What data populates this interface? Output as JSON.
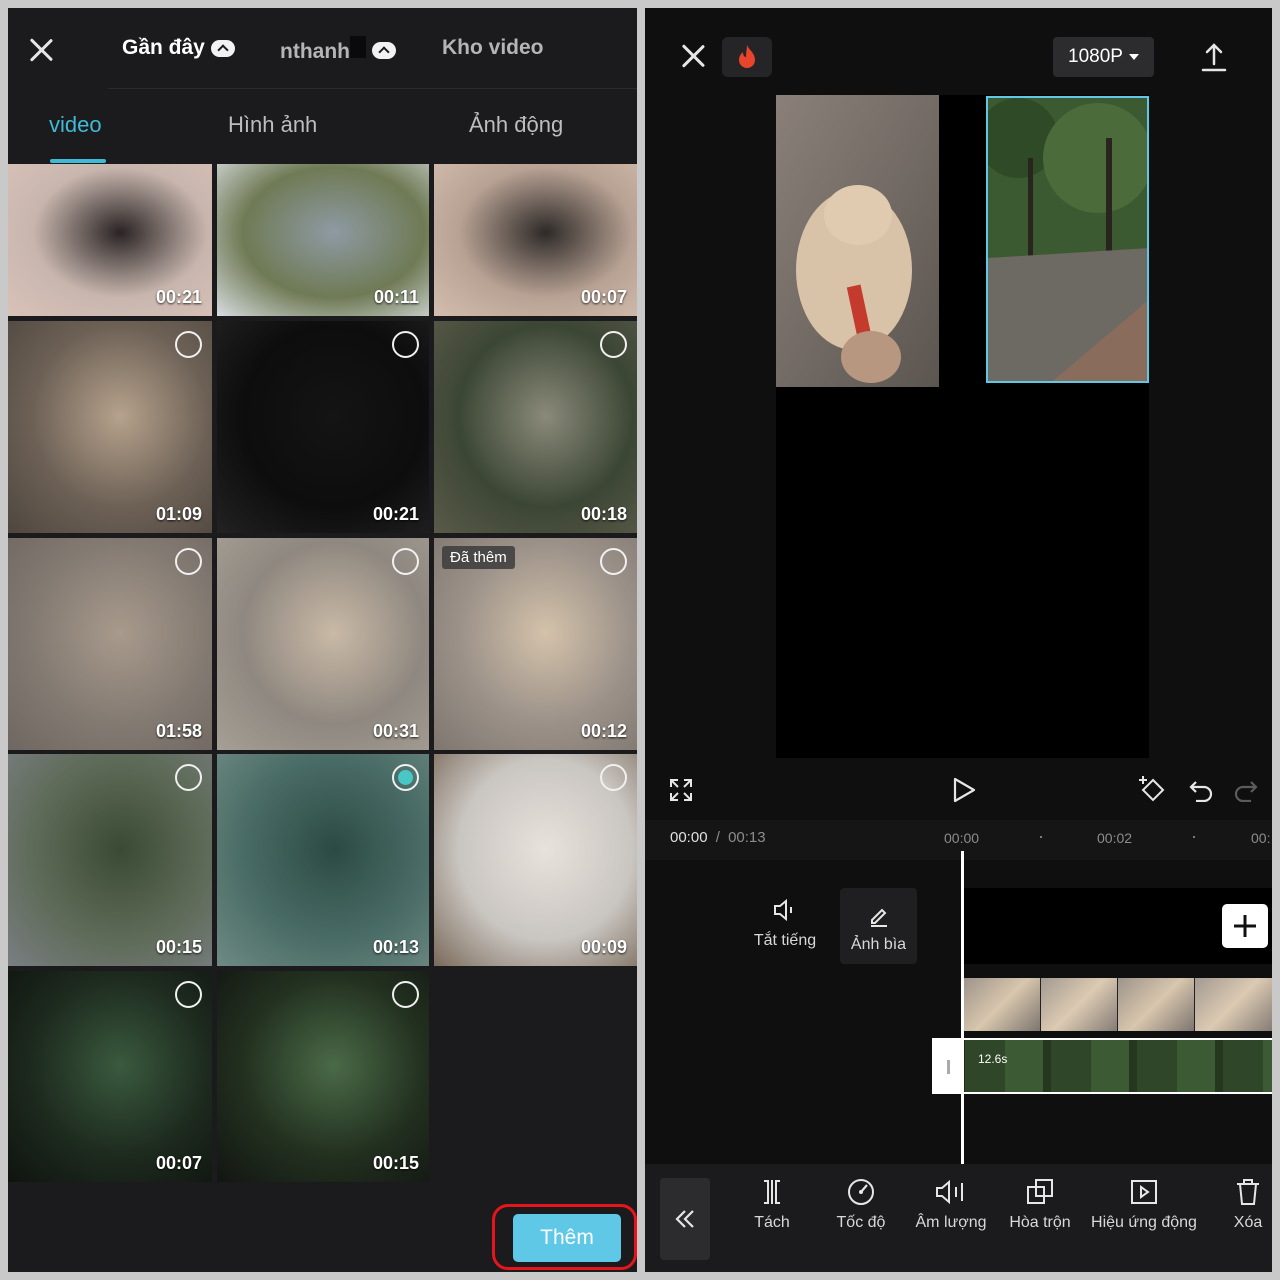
{
  "left": {
    "albums": [
      {
        "label": "Gần đây"
      },
      {
        "label": "nthanh"
      },
      {
        "label": "Kho video"
      }
    ],
    "tabs": [
      "video",
      "Hình ảnh",
      "Ảnh động"
    ],
    "active_tab": "video",
    "media": [
      {
        "duration": "00:21",
        "selectable": false
      },
      {
        "duration": "00:11",
        "selectable": false
      },
      {
        "duration": "00:07",
        "selectable": false
      },
      {
        "duration": "01:09",
        "selectable": true
      },
      {
        "duration": "00:21",
        "selectable": true
      },
      {
        "duration": "00:18",
        "selectable": true
      },
      {
        "duration": "01:58",
        "selectable": true
      },
      {
        "duration": "00:31",
        "selectable": true
      },
      {
        "duration": "00:12",
        "selectable": true,
        "badge": "Đã thêm"
      },
      {
        "duration": "00:15",
        "selectable": true
      },
      {
        "duration": "00:13",
        "selectable": true,
        "selected": true
      },
      {
        "duration": "00:09",
        "selectable": true
      },
      {
        "duration": "00:07",
        "selectable": true
      },
      {
        "duration": "00:15",
        "selectable": true
      }
    ],
    "add_button": "Thêm",
    "accent_color": "#3fb9d6",
    "highlight_color": "#e8141b"
  },
  "right": {
    "resolution": "1080P",
    "time_current": "00:00",
    "time_separator": "/",
    "time_total": "00:13",
    "ruler": [
      "00:00",
      "00:02",
      "00:"
    ],
    "track_tools": [
      {
        "label": "Tắt tiếng",
        "icon": "speaker-icon"
      },
      {
        "label": "Ảnh bìa",
        "icon": "pencil-icon"
      }
    ],
    "clip_label": "12.6s",
    "tools": [
      {
        "label": "Tách",
        "icon": "split-icon"
      },
      {
        "label": "Tốc độ",
        "icon": "speed-icon"
      },
      {
        "label": "Âm lượng",
        "icon": "volume-icon"
      },
      {
        "label": "Hòa trộn",
        "icon": "blend-icon"
      },
      {
        "label": "Hiệu ứng động",
        "icon": "animation-icon"
      },
      {
        "label": "Xóa",
        "icon": "trash-icon"
      }
    ],
    "selection_color": "#5ec8e6"
  }
}
